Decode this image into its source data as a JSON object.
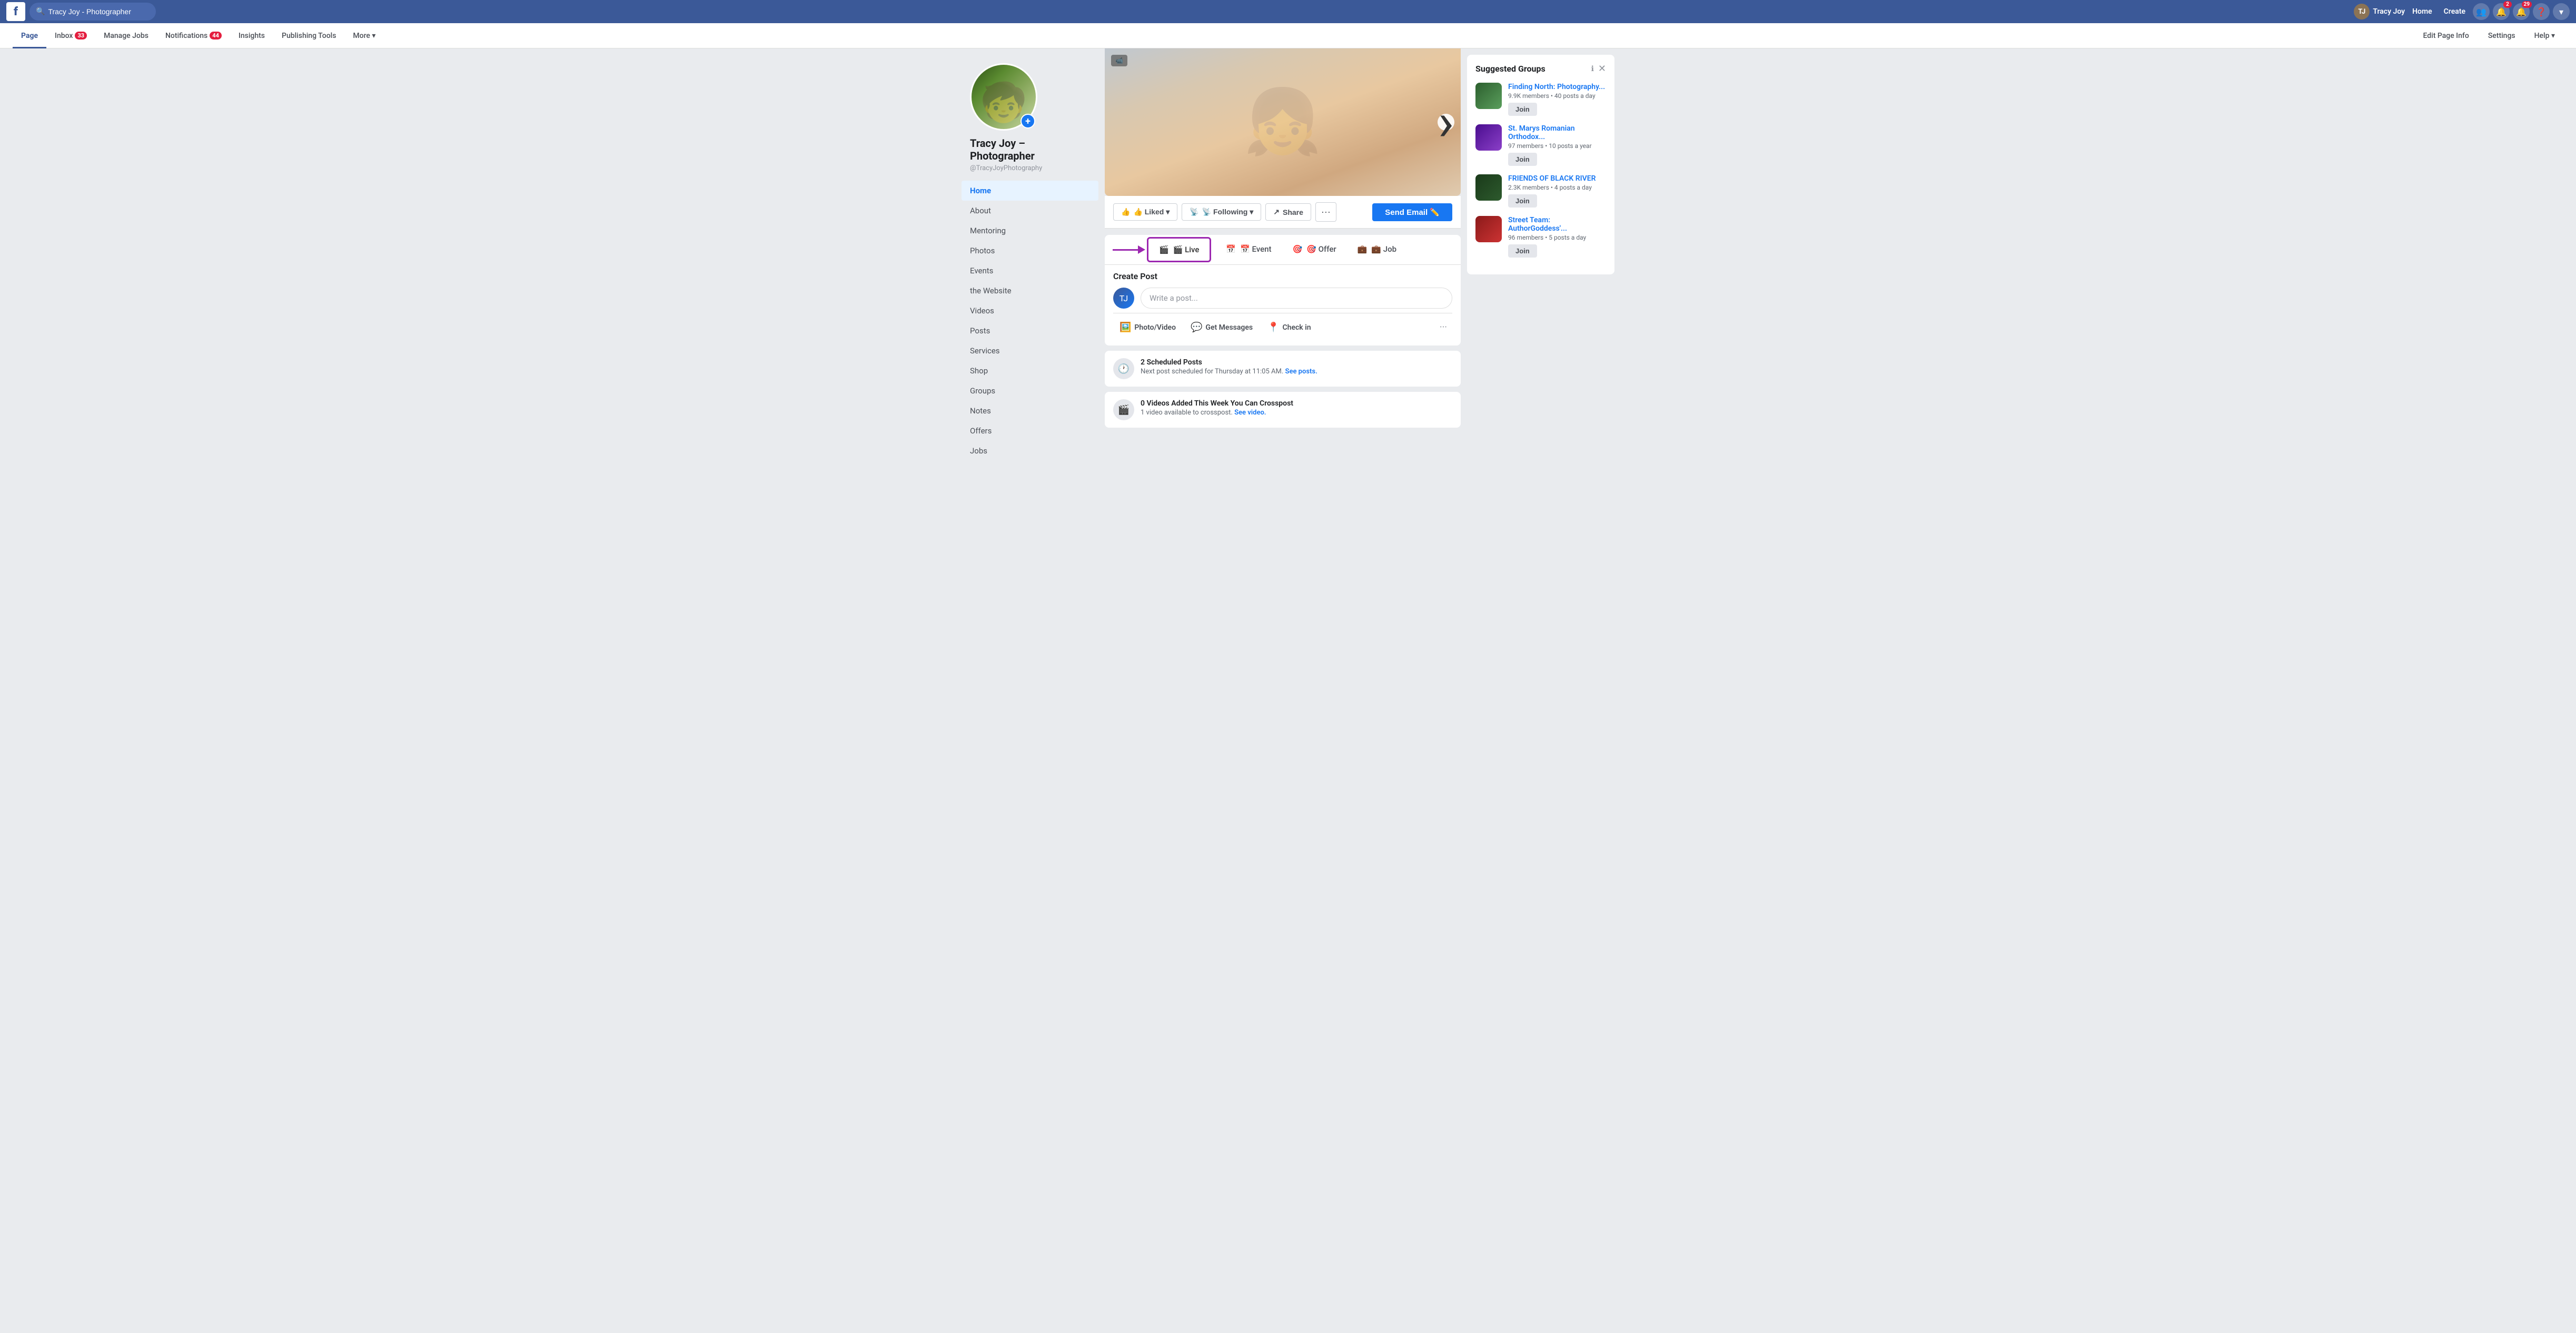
{
  "topnav": {
    "logo": "f",
    "search_value": "Tracy Joy - Photographer",
    "search_placeholder": "Search",
    "username": "Tracy Joy",
    "nav_items": [
      "Home",
      "Create"
    ],
    "friends_icon": "👥",
    "notifications_badge": "2",
    "alerts_badge": "29",
    "help_icon": "?",
    "dropdown_icon": "▾"
  },
  "page_nav": {
    "items": [
      {
        "label": "Page",
        "active": true,
        "badge": null
      },
      {
        "label": "Inbox",
        "active": false,
        "badge": "33"
      },
      {
        "label": "Manage Jobs",
        "active": false,
        "badge": null
      },
      {
        "label": "Notifications",
        "active": false,
        "badge": "44"
      },
      {
        "label": "Insights",
        "active": false,
        "badge": null
      },
      {
        "label": "Publishing Tools",
        "active": false,
        "badge": null
      },
      {
        "label": "More ▾",
        "active": false,
        "badge": null
      }
    ],
    "right_items": [
      "Edit Page Info",
      "Settings",
      "Help ▾"
    ]
  },
  "profile": {
    "name": "Tracy Joy –\nPhotographer",
    "name_line1": "Tracy Joy –",
    "name_line2": "Photographer",
    "handle": "@TracyJoyPhotography"
  },
  "sidebar_menu": {
    "items": [
      {
        "label": "Home",
        "active": true
      },
      {
        "label": "About",
        "active": false
      },
      {
        "label": "Mentoring",
        "active": false
      },
      {
        "label": "Photos",
        "active": false
      },
      {
        "label": "Events",
        "active": false
      },
      {
        "label": "the Website",
        "active": false
      },
      {
        "label": "Videos",
        "active": false
      },
      {
        "label": "Posts",
        "active": false
      },
      {
        "label": "Services",
        "active": false
      },
      {
        "label": "Shop",
        "active": false
      },
      {
        "label": "Groups",
        "active": false
      },
      {
        "label": "Notes",
        "active": false
      },
      {
        "label": "Offers",
        "active": false
      },
      {
        "label": "Jobs",
        "active": false
      }
    ]
  },
  "action_bar": {
    "liked_label": "👍 Liked ▾",
    "following_label": "📡 Following ▾",
    "share_label": "↗ Share",
    "dots_label": "···",
    "send_email_label": "Send Email ✏️"
  },
  "post_tabs": {
    "live_label": "🎬 Live",
    "event_label": "📅 Event",
    "offer_label": "🎯 Offer",
    "job_label": "💼 Job"
  },
  "create_post": {
    "header": "Create Post",
    "placeholder": "Write a post...",
    "photo_video": "Photo/Video",
    "get_messages": "Get Messages",
    "check_in": "Check in"
  },
  "notifications": {
    "scheduled": {
      "icon": "🕐",
      "title": "2 Scheduled Posts",
      "sub": "Next post scheduled for Thursday at 11:05 AM.",
      "link": "See posts."
    },
    "crosspost": {
      "icon": "🎬",
      "title": "0 Videos Added This Week You Can Crosspost",
      "sub": "1 video available to crosspost.",
      "link": "See video."
    }
  },
  "suggested_groups": {
    "title": "Suggested Groups",
    "groups": [
      {
        "name": "Finding North: Photography...",
        "meta": "9.9K members • 40 posts a day",
        "join_label": "Join"
      },
      {
        "name": "St. Marys Romanian Orthodox...",
        "meta": "97 members • 10 posts a year",
        "join_label": "Join"
      },
      {
        "name": "FRIENDS OF BLACK RIVER",
        "meta": "2.3K members • 4 posts a day",
        "join_label": "Join"
      },
      {
        "name": "Street Team: AuthorGoddess'...",
        "meta": "96 members • 5 posts a day",
        "join_label": "Join"
      }
    ]
  },
  "colors": {
    "facebook_blue": "#3b5998",
    "primary_blue": "#1877f2",
    "border": "#ddd",
    "text_dark": "#1c1e21",
    "text_secondary": "#606770",
    "bg_page": "#e9ebee",
    "annotation_purple": "#9c27b0"
  }
}
